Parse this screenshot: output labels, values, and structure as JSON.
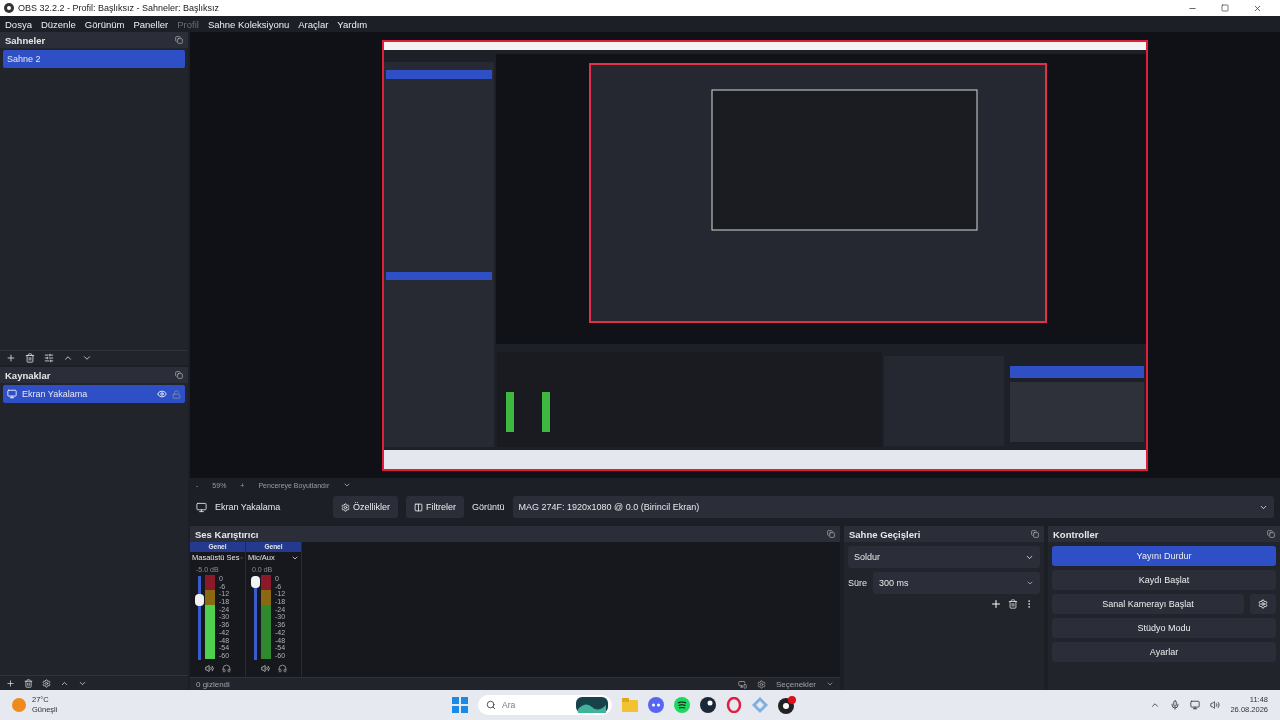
{
  "window": {
    "title": "OBS 32.2.2 - Profil: Başlıksız - Sahneler: Başlıksız"
  },
  "menu": [
    {
      "label": "Dosya",
      "disabled": false
    },
    {
      "label": "Düzenle",
      "disabled": false
    },
    {
      "label": "Görünüm",
      "disabled": false
    },
    {
      "label": "Paneller",
      "disabled": false
    },
    {
      "label": "Profil",
      "disabled": true
    },
    {
      "label": "Sahne Koleksiyonu",
      "disabled": false
    },
    {
      "label": "Araçlar",
      "disabled": false
    },
    {
      "label": "Yardım",
      "disabled": false
    }
  ],
  "scenes": {
    "title": "Sahneler",
    "items": [
      {
        "label": "Sahne 2",
        "selected": true
      }
    ]
  },
  "sources": {
    "title": "Kaynaklar",
    "items": [
      {
        "label": "Ekran Yakalama",
        "selected": true,
        "visible": true,
        "locked": false
      }
    ]
  },
  "zoom": {
    "minus": "-",
    "value": "59%",
    "plus": "+",
    "fit": "Pencereye Boyutlandır"
  },
  "source_bar": {
    "name": "Ekran Yakalama",
    "properties": "Özellikler",
    "filters": "Filtreler",
    "display_label": "Görüntü",
    "display_value": "MAG 274F: 1920x1080 @ 0.0 (Birincil Ekran)"
  },
  "mixer": {
    "title": "Ses Karıştırıcı",
    "hidden": "0 gizlendi",
    "options": "Seçenekler",
    "channels": [
      {
        "header": "Genel",
        "name": "Masaüstü Ses",
        "reading": "-5.0 dB",
        "level": 0.75,
        "muted": false,
        "scale": [
          "0",
          "-6",
          "-12",
          "-18",
          "-24",
          "-30",
          "-36",
          "-42",
          "-48",
          "-54",
          "-60"
        ]
      },
      {
        "header": "Genel",
        "name": "Mic/Aux",
        "reading": "0.0 dB",
        "level": 1,
        "muted": false,
        "scale": [
          "0",
          "-6",
          "-12",
          "-18",
          "-24",
          "-30",
          "-36",
          "-42",
          "-48",
          "-54",
          "-60"
        ]
      }
    ]
  },
  "transitions": {
    "title": "Sahne Geçişleri",
    "type": "Soldur",
    "duration_label": "Süre",
    "duration": "300 ms"
  },
  "controls": {
    "title": "Kontroller",
    "buttons": [
      {
        "label": "Yayını Durdur",
        "active": true,
        "settings": false
      },
      {
        "label": "Kaydı Başlat",
        "active": false,
        "settings": false
      },
      {
        "label": "Sanal Kamerayı Başlat",
        "active": false,
        "settings": true
      },
      {
        "label": "Stüdyo Modu",
        "active": false,
        "settings": false
      },
      {
        "label": "Ayarlar",
        "active": false,
        "settings": false
      }
    ]
  },
  "taskbar": {
    "temperature": "27°C",
    "weather": "Güneşli",
    "search": "Ara",
    "time": "11:48",
    "date": "26.08.2026"
  }
}
